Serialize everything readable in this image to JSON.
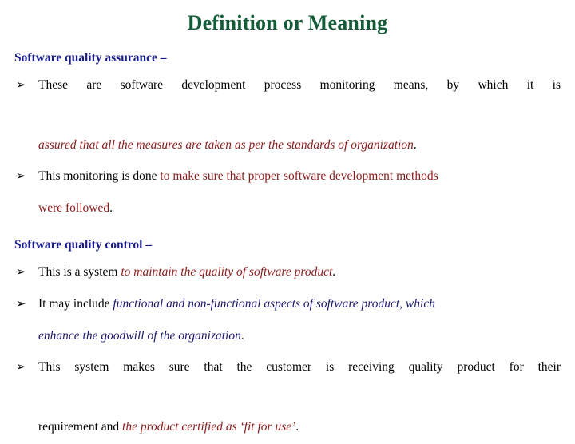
{
  "slide": {
    "title": "Definition or Meaning",
    "colors": {
      "title": "#145c38",
      "heading": "#181c8c",
      "body": "#000000",
      "accent_maroon": "#8b1a1a",
      "accent_navy": "#191970",
      "background": "#ffffff"
    },
    "bullet_glyph": "➢",
    "sections": [
      {
        "heading": "Software quality assurance",
        "heading_dash": " –",
        "bullets": [
          {
            "line1_black": "These are software development process monitoring means, by which it is",
            "line2_italic_maroon": "assured that all the measures are taken as per the standards of organization",
            "line2_end_black": "."
          },
          {
            "line1_black": "This monitoring is done ",
            "line1_maroon": "to make sure that proper software development methods",
            "line2_maroon": "were followed",
            "line2_end_black": "."
          }
        ]
      },
      {
        "heading": "Software quality control",
        "heading_dash": " –",
        "bullets": [
          {
            "line1_black": "This is a system ",
            "line1_maroon_italic": "to maintain the quality of software product",
            "line1_end_black": "."
          },
          {
            "line1_black": "It may include ",
            "line1_navy_italic": "functional and non-functional aspects of software product,  which",
            "line2_navy_italic": "enhance the goodwill of the organization",
            "line2_end_black": "."
          },
          {
            "line1_black": "This system makes sure that the customer is receiving quality product for their",
            "line2_black": "requirement and ",
            "line2_maroon_italic": "the product certified as ‘fit for use’",
            "line2_end_black": "."
          }
        ]
      }
    ]
  }
}
